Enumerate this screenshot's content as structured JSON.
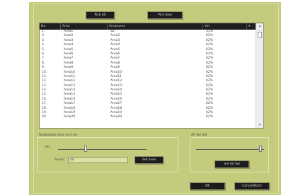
{
  "toolbar": {
    "btn_left": "Pick All",
    "btn_right": "Pick Row"
  },
  "table": {
    "columns": [
      "No",
      "Area",
      "Areaname",
      "Vol"
    ],
    "rows": [
      [
        "1.",
        "Area1",
        "aa",
        "31%"
      ],
      [
        "2.",
        "Area2",
        "Area2",
        "62%"
      ],
      [
        "3.",
        "Area3",
        "Area3",
        "62%"
      ],
      [
        "4.",
        "Area4",
        "Area4",
        "62%"
      ],
      [
        "5.",
        "Area5",
        "Area5",
        "62%"
      ],
      [
        "6.",
        "Area6",
        "Area6",
        "62%"
      ],
      [
        "7.",
        "Area7",
        "Area7",
        "62%"
      ],
      [
        "8.",
        "Area8",
        "Area8",
        "62%"
      ],
      [
        "9.",
        "Area9",
        "Area9",
        "62%"
      ],
      [
        "10.",
        "Area10",
        "Area10",
        "62%"
      ],
      [
        "11.",
        "Area11",
        "Area11",
        "62%"
      ],
      [
        "12.",
        "Area12",
        "Area12",
        "62%"
      ],
      [
        "13.",
        "Area13",
        "Area13",
        "62%"
      ],
      [
        "14.",
        "Area14",
        "Area14",
        "62%"
      ],
      [
        "15.",
        "Area15",
        "Area15",
        "62%"
      ],
      [
        "16.",
        "Area16",
        "Area16",
        "62%"
      ],
      [
        "17.",
        "Area17",
        "Area17",
        "62%"
      ],
      [
        "18.",
        "Area18",
        "Area18",
        "62%"
      ],
      [
        "19.",
        "Area19",
        "Area19",
        "62%"
      ],
      [
        "20.",
        "Area20",
        "Area20",
        "62%"
      ]
    ]
  },
  "single_area": {
    "group_label": "Singlebase area and vol",
    "vol_label": "Vol:",
    "vol_level": 0.31,
    "area_label": "Area1:",
    "area_value": "aa",
    "set_button": "Set Area"
  },
  "all_vol": {
    "group_label": "All Vol Set",
    "vol_level": 0.95,
    "set_button": "Set All Vol"
  },
  "footer": {
    "ok_button": "OK",
    "cancel_button": "Cancel/Back"
  }
}
